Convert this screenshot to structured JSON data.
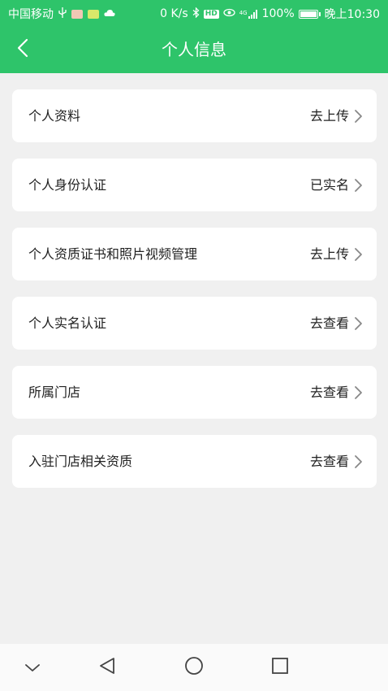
{
  "status_bar": {
    "carrier": "中国移动",
    "network_speed": "0 K/s",
    "battery_percent": "100%",
    "time": "晚上10:30",
    "hd_label": "HD",
    "signal_label": "4G",
    "icons": [
      "usb-icon",
      "app-notification-icon",
      "app-notification-icon",
      "cloud-icon",
      "bluetooth-icon",
      "hd-icon",
      "eye-icon",
      "signal-icon",
      "battery-icon"
    ]
  },
  "header": {
    "title": "个人信息",
    "back_icon": "chevron-left-icon",
    "background_color": "#2ec46a"
  },
  "items": [
    {
      "label": "个人资料",
      "action": "去上传"
    },
    {
      "label": "个人身份认证",
      "action": "已实名"
    },
    {
      "label": "个人资质证书和照片视频管理",
      "action": "去上传"
    },
    {
      "label": "个人实名认证",
      "action": "去查看"
    },
    {
      "label": "所属门店",
      "action": "去查看"
    },
    {
      "label": "入驻门店相关资质",
      "action": "去查看"
    }
  ],
  "system_nav": {
    "buttons": [
      "chevron-down-icon",
      "back-triangle-icon",
      "home-circle-icon",
      "recents-square-icon"
    ]
  }
}
